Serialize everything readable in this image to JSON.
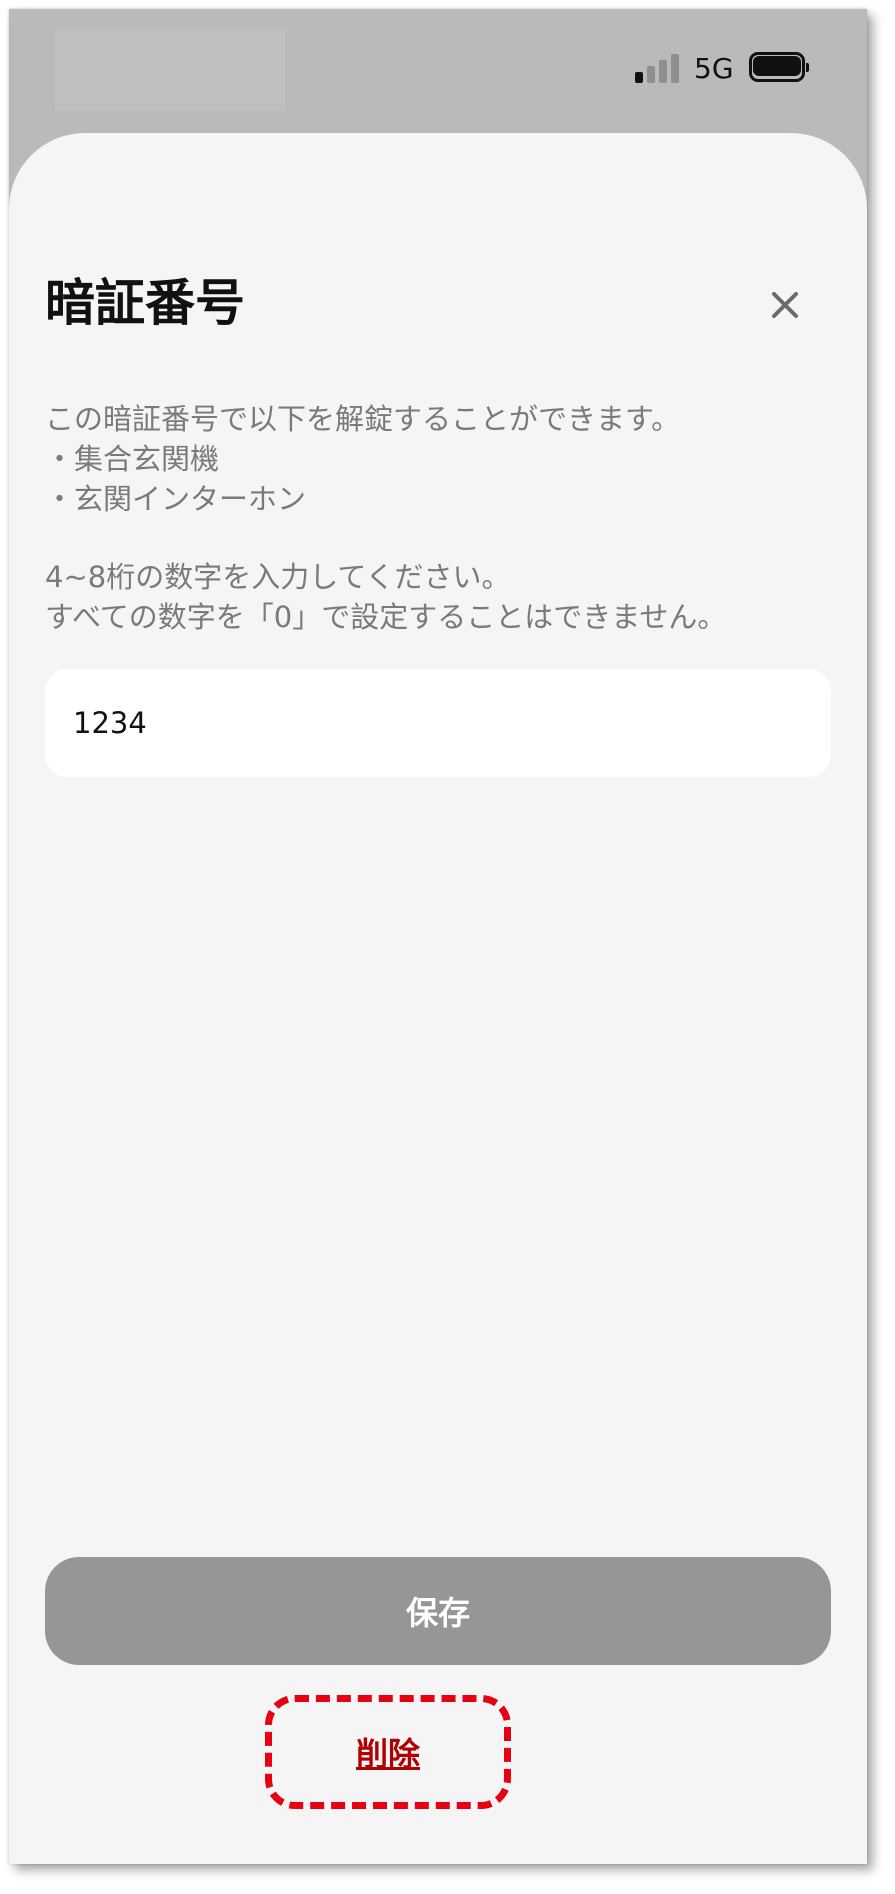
{
  "status_bar": {
    "network": "5G",
    "signal_bars_active": 1,
    "signal_bars_total": 4,
    "battery_icon": "battery-full-icon"
  },
  "sheet": {
    "title": "暗証番号",
    "close_icon": "close-icon",
    "description": {
      "line1": "この暗証番号で以下を解錠することができます。",
      "line2": "・集合玄関機",
      "line3": "・玄関インターホン",
      "line4": "4~8桁の数字を入力してください。",
      "line5": "すべての数字を「0」で設定することはできません。"
    },
    "pin_input": {
      "value": "1234",
      "placeholder": ""
    },
    "save_label": "保存",
    "delete_label": "削除"
  },
  "colors": {
    "background_dim": "#b9bbb9",
    "sheet": "#f5f5f5",
    "save_button": "#969696",
    "delete_text": "#b00000",
    "highlight": "#e60012"
  }
}
